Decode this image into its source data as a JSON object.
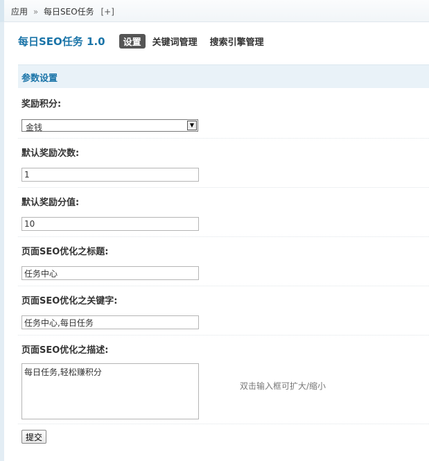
{
  "breadcrumb": {
    "root": "应用",
    "separator": "»",
    "current": "每日SEO任务",
    "add": "[+]"
  },
  "header": {
    "title": "每日SEO任务 1.0",
    "tabs": [
      "设置",
      "关键词管理",
      "搜索引擎管理"
    ]
  },
  "section": {
    "title": "参数设置"
  },
  "form": {
    "reward_credit": {
      "label": "奖励积分:",
      "selected": "金钱"
    },
    "default_count": {
      "label": "默认奖励次数:",
      "value": "1"
    },
    "default_value": {
      "label": "默认奖励分值:",
      "value": "10"
    },
    "seo_title": {
      "label": "页面SEO优化之标题:",
      "value": "任务中心"
    },
    "seo_keywords": {
      "label": "页面SEO优化之关键字:",
      "value": "任务中心,每日任务"
    },
    "seo_description": {
      "label": "页面SEO优化之描述:",
      "value": "每日任务,轻松赚积分",
      "hint": "双击输入框可扩大/缩小"
    },
    "submit_label": "提交"
  },
  "colors": {
    "accent": "#1a74a8",
    "section_bg": "#e9f2f8"
  }
}
